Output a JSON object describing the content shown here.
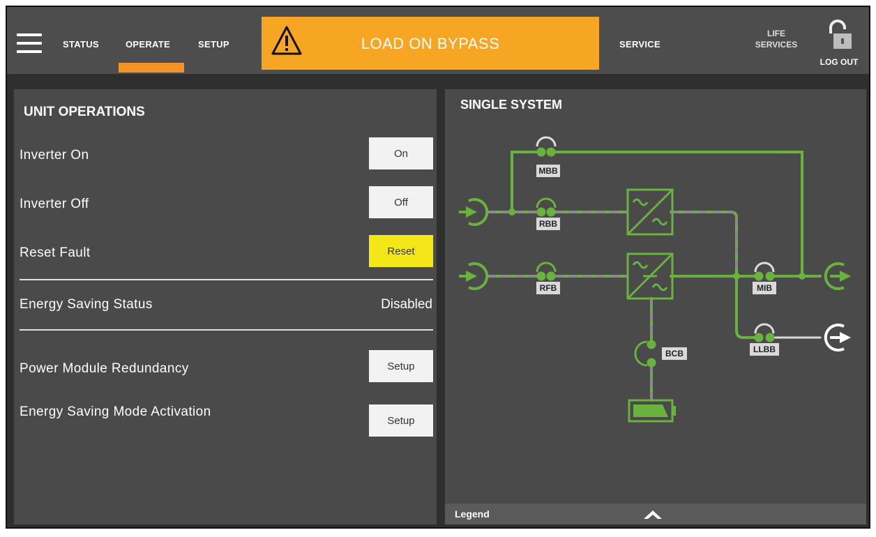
{
  "nav": {
    "status": "STATUS",
    "operate": "OPERATE",
    "setup": "SETUP",
    "service": "SERVICE",
    "life_services_line1": "LIFE",
    "life_services_line2": "SERVICES",
    "logout": "LOG OUT"
  },
  "alarm": {
    "text": "LOAD ON BYPASS",
    "color": "#f6a623"
  },
  "unit_operations": {
    "title": "UNIT OPERATIONS",
    "inverter_on_label": "Inverter On",
    "inverter_on_button": "On",
    "inverter_off_label": "Inverter Off",
    "inverter_off_button": "Off",
    "reset_fault_label": "Reset Fault",
    "reset_fault_button": "Reset",
    "energy_saving_status_label": "Energy Saving Status",
    "energy_saving_status_value": "Disabled",
    "power_module_redundancy_label": "Power Module Redundancy",
    "power_module_redundancy_button": "Setup",
    "energy_saving_mode_label": "Energy Saving Mode Activation",
    "energy_saving_mode_button": "Setup"
  },
  "single_system": {
    "title": "SINGLE SYSTEM",
    "breakers": {
      "mbb": "MBB",
      "rbb": "RBB",
      "rfb": "RFB",
      "mib": "MIB",
      "llbb": "LLBB",
      "bcb": "BCB"
    },
    "legend": "Legend"
  },
  "colors": {
    "accent": "#f5922a",
    "flow": "#6ab23e",
    "reset_button": "#f4e718"
  }
}
